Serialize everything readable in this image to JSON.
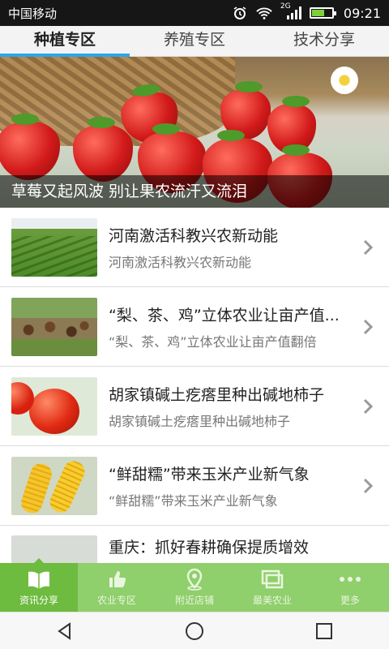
{
  "status_bar": {
    "carrier": "中国移动",
    "network": "2G",
    "time": "09:21",
    "icons": [
      "alarm-icon",
      "wifi-icon",
      "signal-icon",
      "battery-icon"
    ]
  },
  "top_tabs": [
    {
      "label": "种植专区",
      "active": true
    },
    {
      "label": "养殖专区",
      "active": false
    },
    {
      "label": "技术分享",
      "active": false
    }
  ],
  "banner": {
    "caption": "草莓又起风波 别让果农流汗又流泪"
  },
  "news": [
    {
      "title": "河南激活科教兴农新动能",
      "subtitle": "河南激活科教兴农新动能"
    },
    {
      "title": "“梨、茶、鸡”立体农业让亩产值...",
      "subtitle": "“梨、茶、鸡”立体农业让亩产值翻倍"
    },
    {
      "title": "胡家镇碱土疙瘩里种出碱地柿子",
      "subtitle": "胡家镇碱土疙瘩里种出碱地柿子"
    },
    {
      "title": "“鲜甜糯”带来玉米产业新气象",
      "subtitle": "“鲜甜糯”带来玉米产业新气象"
    },
    {
      "title": "重庆：抓好春耕确保提质增效",
      "subtitle": ""
    }
  ],
  "bottom_nav": [
    {
      "label": "资讯分享",
      "icon": "book-icon",
      "active": true
    },
    {
      "label": "农业专区",
      "icon": "thumbs-up-icon",
      "active": false
    },
    {
      "label": "附近店铺",
      "icon": "location-pin-icon",
      "active": false
    },
    {
      "label": "最美农业",
      "icon": "windows-icon",
      "active": false
    },
    {
      "label": "更多",
      "icon": "more-dots-icon",
      "active": false
    }
  ],
  "colors": {
    "tab_indicator": "#2aa7ea",
    "bottom_nav_bg": "#8fcf6c",
    "bottom_nav_active": "#6dbb3f"
  }
}
